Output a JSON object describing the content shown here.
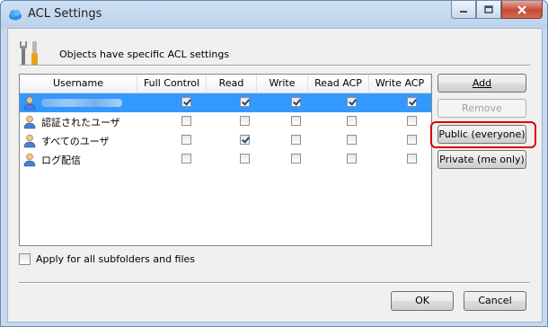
{
  "window": {
    "title": "ACL Settings"
  },
  "header": {
    "text": "Objects have specific ACL settings"
  },
  "columns": [
    "Username",
    "Full Control",
    "Read",
    "Write",
    "Read ACP",
    "Write ACP"
  ],
  "rows": [
    {
      "username": "",
      "obscured": true,
      "selected": true,
      "perms": [
        true,
        true,
        true,
        true,
        true
      ]
    },
    {
      "username": "認証されたユーザ",
      "obscured": false,
      "selected": false,
      "perms": [
        false,
        false,
        false,
        false,
        false
      ]
    },
    {
      "username": "すべてのユーザ",
      "obscured": false,
      "selected": false,
      "perms": [
        false,
        true,
        false,
        false,
        false
      ]
    },
    {
      "username": "ログ配信",
      "obscured": false,
      "selected": false,
      "perms": [
        false,
        false,
        false,
        false,
        false
      ]
    }
  ],
  "buttons": {
    "add": "Add",
    "remove": "Remove",
    "public": "Public (everyone)",
    "private": "Private (me only)",
    "ok": "OK",
    "cancel": "Cancel"
  },
  "apply_all": {
    "label": "Apply for all subfolders and files",
    "checked": false
  },
  "icons": {
    "app": "cloud-icon",
    "header": "tools-icon",
    "user": "user-icon"
  }
}
